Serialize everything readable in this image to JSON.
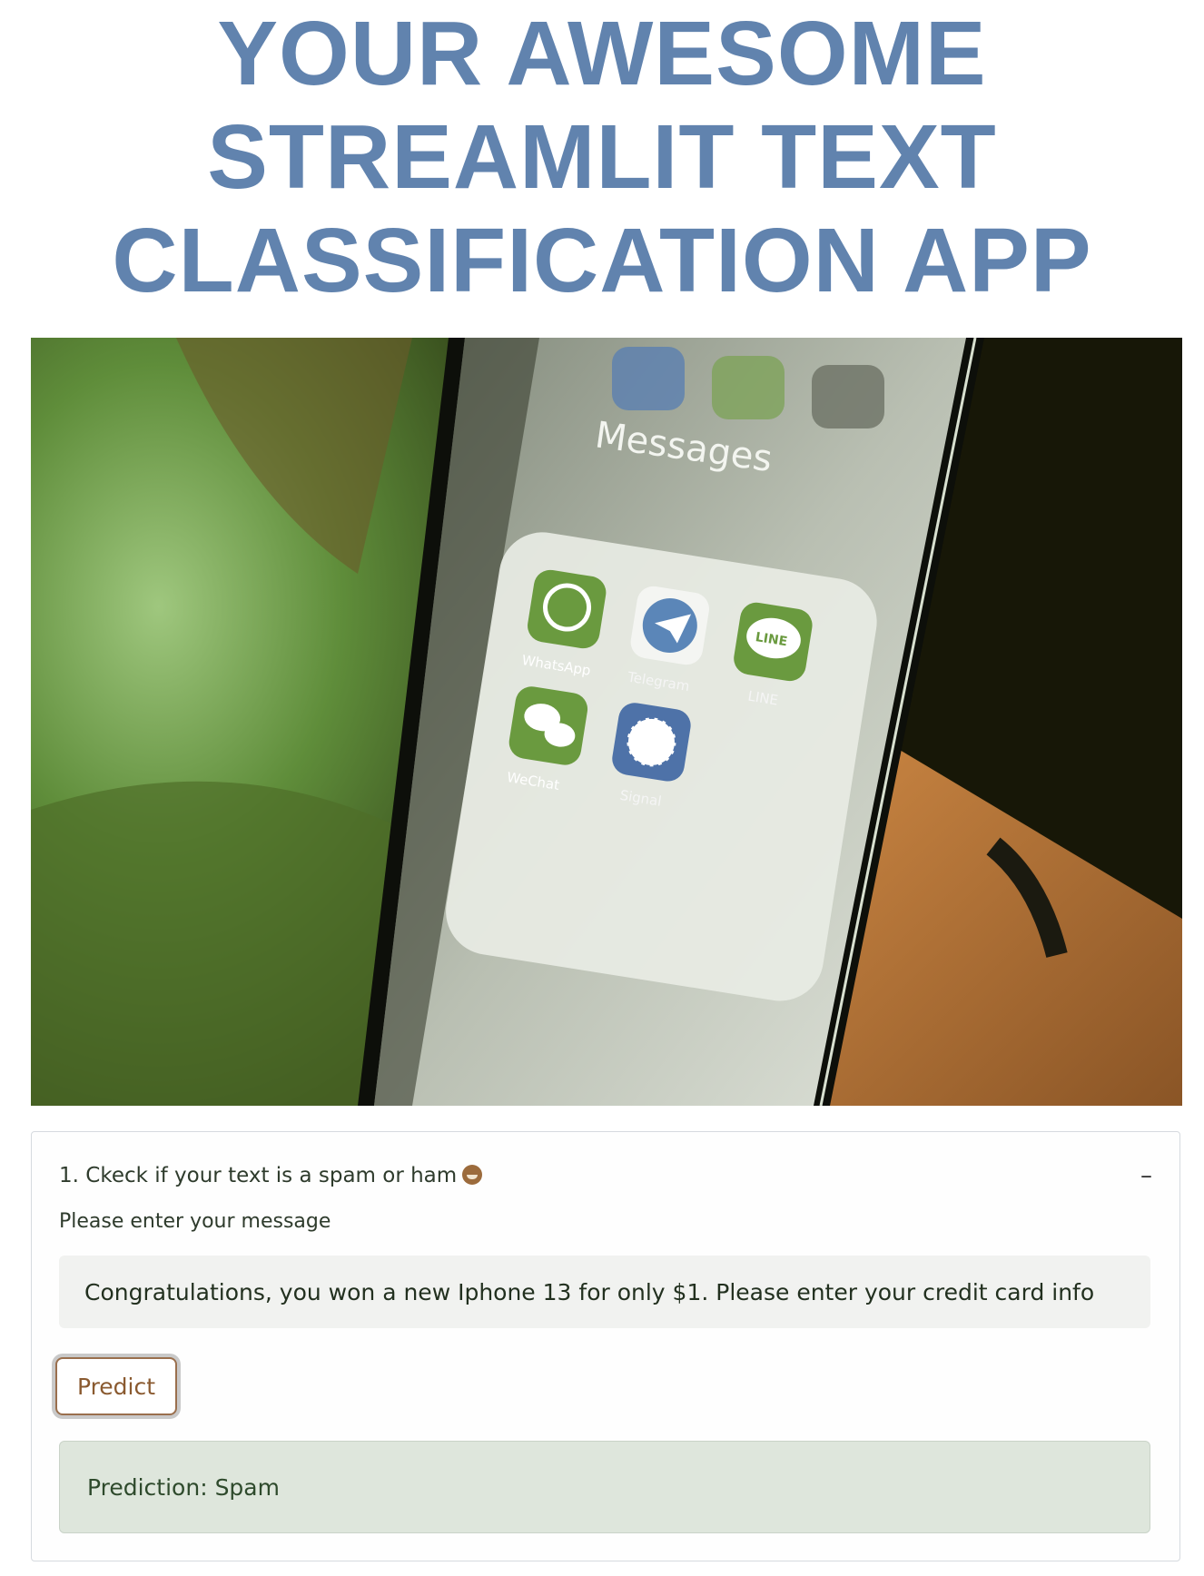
{
  "title_lines": [
    "YOUR AWESOME",
    "STREAMLIT TEXT",
    "CLASSIFICATION APP"
  ],
  "hero": {
    "screen_title": "Messages",
    "apps": [
      "WhatsApp",
      "Telegram",
      "LINE",
      "WeChat",
      "Signal"
    ],
    "line_badge": "LINE"
  },
  "expander": {
    "header": "1. Ckeck if your text is a spam or ham",
    "toggle_symbol": "–",
    "input_label": "Please enter your message",
    "input_value": "Congratulations, you won a new Iphone 13 for only $1. Please enter your credit card info",
    "button_label": "Predict",
    "result": "Prediction: Spam"
  },
  "colors": {
    "title": "#6183ae",
    "button_border": "#9a6f4d",
    "result_bg": "#dee6dc"
  }
}
